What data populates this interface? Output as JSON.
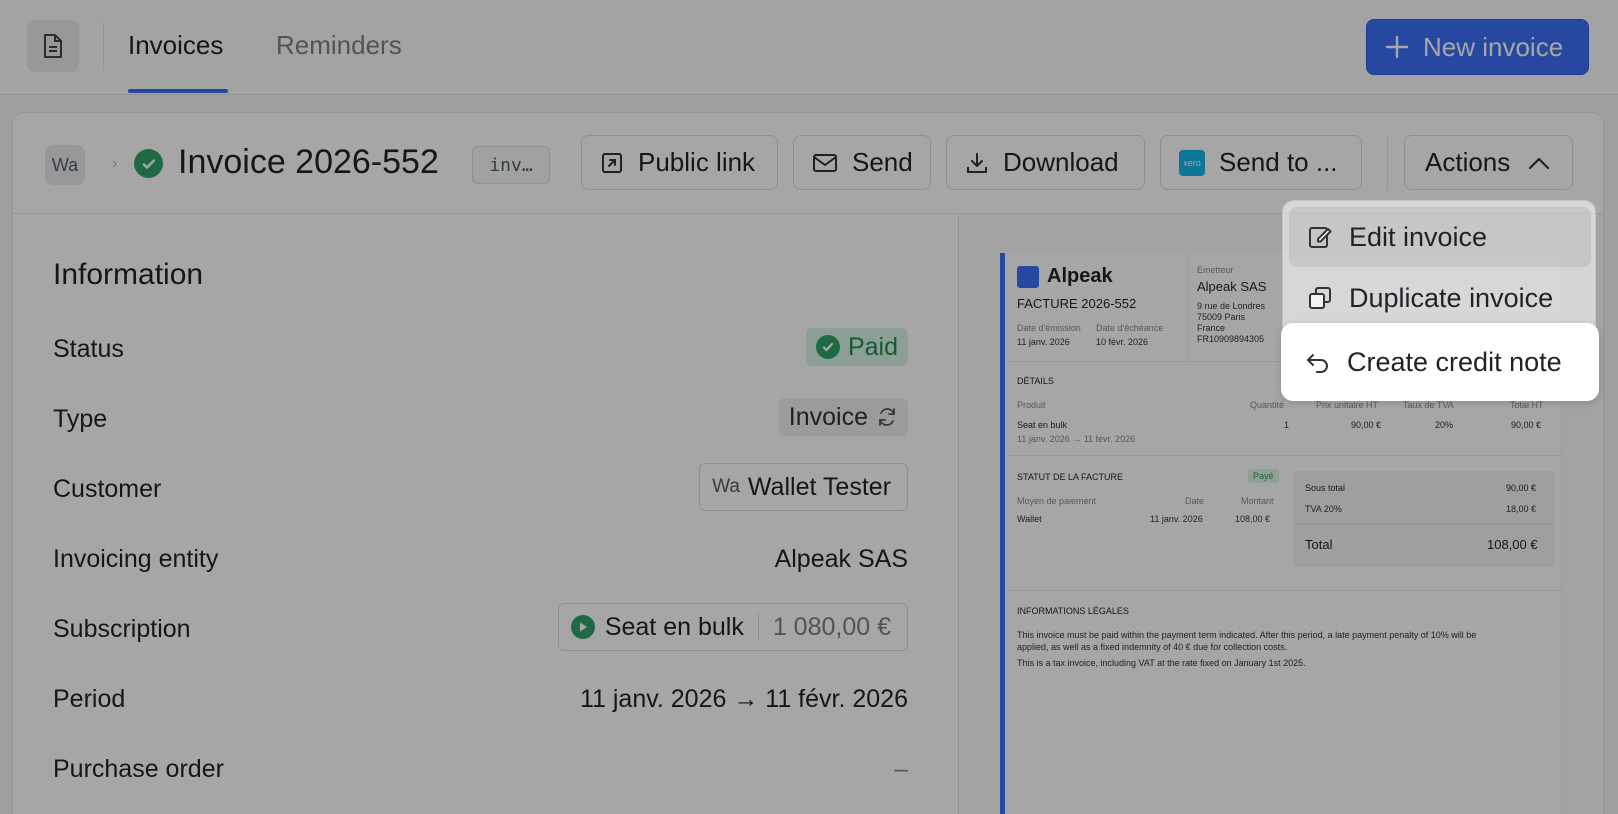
{
  "topnav": {
    "tabs": [
      {
        "label": "Invoices",
        "active": true
      },
      {
        "label": "Reminders",
        "active": false
      }
    ],
    "new_invoice_label": "New invoice"
  },
  "header": {
    "customer_initials": "Wa",
    "invoice_title": "Invoice 2026-552",
    "invoice_id_chip": "inv…",
    "buttons": {
      "public_link": "Public link",
      "send": "Send",
      "download": "Download",
      "send_to": "Send to ...",
      "xero_badge": "xero",
      "actions": "Actions"
    }
  },
  "info": {
    "title": "Information",
    "rows": {
      "status": {
        "label": "Status",
        "value": "Paid"
      },
      "type": {
        "label": "Type",
        "value": "Invoice"
      },
      "customer": {
        "label": "Customer",
        "initials": "Wa",
        "value": "Wallet Tester"
      },
      "entity": {
        "label": "Invoicing entity",
        "value": "Alpeak SAS"
      },
      "subscription": {
        "label": "Subscription",
        "value": "Seat en bulk",
        "amount": "1 080,00 €"
      },
      "period": {
        "label": "Period",
        "value": "11 janv. 2026 → 11 févr. 2026"
      },
      "purchase_order": {
        "label": "Purchase order",
        "value": "–"
      }
    }
  },
  "preview": {
    "brand": "Alpeak",
    "doc_title": "FACTURE 2026-552",
    "issue_label": "Date d'émission",
    "issue_date": "11 janv. 2026",
    "due_label": "Date d'échéance",
    "due_date": "10 févr. 2026",
    "emitter_label": "Emetteur",
    "emitter_name": "Alpeak SAS",
    "emitter_addr1": "9 rue de Londres",
    "emitter_addr2": "75009 Paris",
    "emitter_addr3": "France",
    "emitter_vat": "FR10909894305",
    "details_title": "DÉTAILS",
    "col_product": "Produit",
    "col_qty": "Quantité",
    "col_unit": "Prix unitaire HT",
    "col_vat": "Taux de TVA",
    "col_total": "Total HT",
    "line_product": "Seat en bulk",
    "line_period": "11 janv. 2026 → 11 févr. 2026",
    "line_qty": "1",
    "line_unit": "90,00 €",
    "line_vat": "20%",
    "line_total": "90,00 €",
    "status_title": "STATUT DE LA FACTURE",
    "status_badge": "Payé",
    "pay_method_label": "Moyen de paiement",
    "pay_date_label": "Date",
    "pay_amount_label": "Montant",
    "pay_method": "Wallet",
    "pay_date": "11 janv. 2026",
    "pay_amount": "108,00 €",
    "subtotal_label": "Sous total",
    "subtotal": "90,00 €",
    "tva_label": "TVA 20%",
    "tva": "18,00 €",
    "total_label": "Total",
    "total": "108,00 €",
    "legal_title": "INFORMATIONS LÉGALES",
    "legal_1a": "This invoice must be paid within the payment term indicated. After this period, a late payment penalty of 10% will be",
    "legal_1b": "applied, as well as a fixed indemnity of 40 € due for collection costs.",
    "legal_2": "This is a tax invoice, including VAT at the rate fixed on January 1st 2025."
  },
  "actions_menu": {
    "items": [
      {
        "label": "Edit invoice"
      },
      {
        "label": "Duplicate invoice"
      },
      {
        "label": "Create credit note"
      }
    ]
  },
  "colors": {
    "accent": "#3d6ff6",
    "success": "#2ea567",
    "xero": "#13b5ea"
  }
}
